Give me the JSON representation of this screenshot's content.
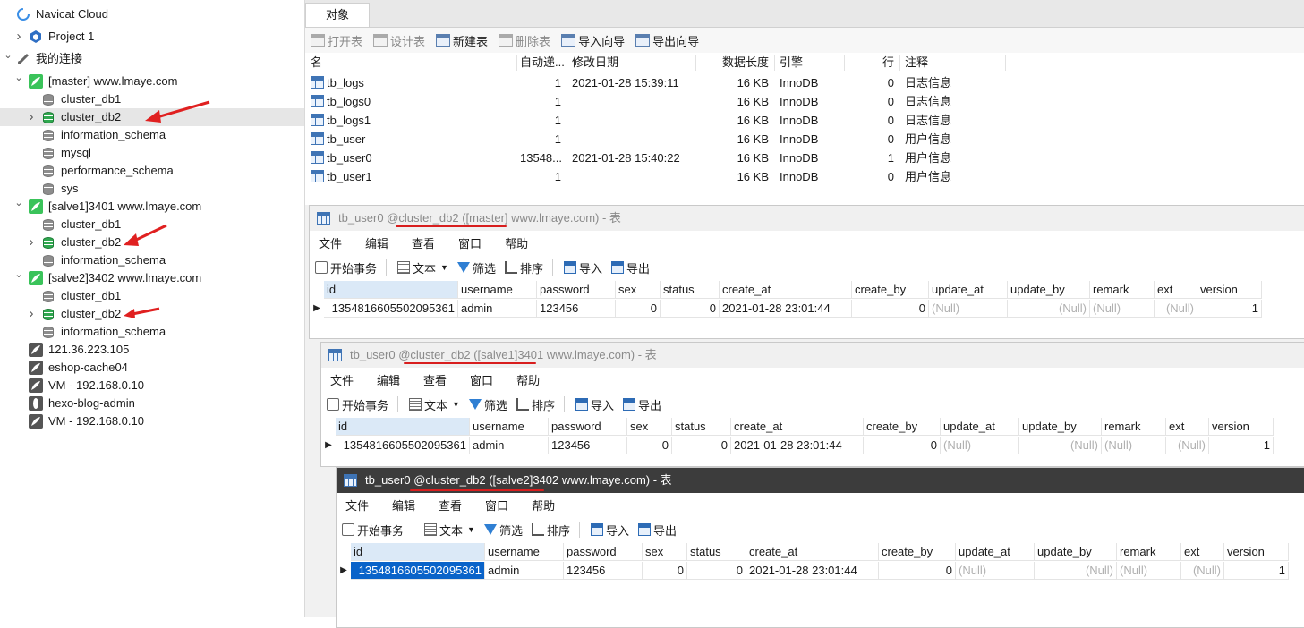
{
  "sidebar": {
    "items": [
      {
        "label": "Navicat Cloud",
        "icon": "cloud-icon"
      },
      {
        "label": "Project 1",
        "icon": "project-icon"
      },
      {
        "label": "我的连接",
        "icon": "connections-icon"
      },
      {
        "label": "[master] www.lmaye.com",
        "icon": "mysql-connection-icon"
      },
      {
        "label": "cluster_db1",
        "icon": "database-icon"
      },
      {
        "label": "cluster_db2",
        "icon": "database-open-icon",
        "selected": true
      },
      {
        "label": "information_schema",
        "icon": "database-icon"
      },
      {
        "label": "mysql",
        "icon": "database-icon"
      },
      {
        "label": "performance_schema",
        "icon": "database-icon"
      },
      {
        "label": "sys",
        "icon": "database-icon"
      },
      {
        "label": "[salve1]3401 www.lmaye.com",
        "icon": "mysql-connection-icon"
      },
      {
        "label": "cluster_db1",
        "icon": "database-icon"
      },
      {
        "label": "cluster_db2",
        "icon": "database-open-icon"
      },
      {
        "label": "information_schema",
        "icon": "database-icon"
      },
      {
        "label": "[salve2]3402 www.lmaye.com",
        "icon": "mysql-connection-icon"
      },
      {
        "label": "cluster_db1",
        "icon": "database-icon"
      },
      {
        "label": "cluster_db2",
        "icon": "database-open-icon"
      },
      {
        "label": "information_schema",
        "icon": "database-icon"
      },
      {
        "label": "121.36.223.105",
        "icon": "mysql-connection-icon"
      },
      {
        "label": "eshop-cache04",
        "icon": "mysql-connection-icon"
      },
      {
        "label": "VM - 192.168.0.10",
        "icon": "mysql-connection-icon"
      },
      {
        "label": "hexo-blog-admin",
        "icon": "postgres-connection-icon"
      },
      {
        "label": "VM - 192.168.0.10",
        "icon": "mongodb-connection-icon"
      }
    ]
  },
  "tabs": {
    "objects": "对象"
  },
  "object_toolbar": {
    "open_table": "打开表",
    "design_table": "设计表",
    "new_table": "新建表",
    "delete_table": "删除表",
    "import_wizard": "导入向导",
    "export_wizard": "导出向导"
  },
  "object_list": {
    "headers": {
      "name": "名",
      "auto_inc": "自动递...",
      "modified": "修改日期",
      "data_length": "数据长度",
      "engine": "引擎",
      "rows": "行",
      "comment": "注释"
    },
    "rows": [
      {
        "name": "tb_logs",
        "auto_inc": "1",
        "modified": "2021-01-28 15:39:11",
        "data_length": "16 KB",
        "engine": "InnoDB",
        "rows": "0",
        "comment": "日志信息"
      },
      {
        "name": "tb_logs0",
        "auto_inc": "1",
        "modified": "",
        "data_length": "16 KB",
        "engine": "InnoDB",
        "rows": "0",
        "comment": "日志信息"
      },
      {
        "name": "tb_logs1",
        "auto_inc": "1",
        "modified": "",
        "data_length": "16 KB",
        "engine": "InnoDB",
        "rows": "0",
        "comment": "日志信息"
      },
      {
        "name": "tb_user",
        "auto_inc": "1",
        "modified": "",
        "data_length": "16 KB",
        "engine": "InnoDB",
        "rows": "0",
        "comment": "用户信息"
      },
      {
        "name": "tb_user0",
        "auto_inc": "13548...",
        "modified": "2021-01-28 15:40:22",
        "data_length": "16 KB",
        "engine": "InnoDB",
        "rows": "1",
        "comment": "用户信息"
      },
      {
        "name": "tb_user1",
        "auto_inc": "1",
        "modified": "",
        "data_length": "16 KB",
        "engine": "InnoDB",
        "rows": "0",
        "comment": "用户信息"
      }
    ]
  },
  "query_menu": {
    "file": "文件",
    "edit": "编辑",
    "view": "查看",
    "window": "窗口",
    "help": "帮助"
  },
  "query_toolbar": {
    "begin_txn": "开始事务",
    "text": "文本",
    "filter": "筛选",
    "sort": "排序",
    "import": "导入",
    "export": "导出"
  },
  "grid_headers": [
    "id",
    "username",
    "password",
    "sex",
    "status",
    "create_at",
    "create_by",
    "update_at",
    "update_by",
    "remark",
    "ext",
    "version"
  ],
  "windows": [
    {
      "title_prefix": "tb_user0 ",
      "title_highlight": "@cluster_db2 ([master]",
      "title_suffix": " www.lmaye.com) - 表",
      "row": [
        "1354816605502095361",
        "admin",
        "123456",
        "0",
        "0",
        "2021-01-28 23:01:44",
        "0",
        "(Null)",
        "(Null)",
        "(Null)",
        "(Null)",
        "1"
      ]
    },
    {
      "title_prefix": "tb_user0 ",
      "title_highlight": "@cluster_db2 ([salve1]3401",
      "title_suffix": " www.lmaye.com) - 表",
      "row": [
        "1354816605502095361",
        "admin",
        "123456",
        "0",
        "0",
        "2021-01-28 23:01:44",
        "0",
        "(Null)",
        "(Null)",
        "(Null)",
        "(Null)",
        "1"
      ]
    },
    {
      "title_prefix": "tb_user0 ",
      "title_highlight": "@cluster_db2 ([salve2]3402",
      "title_suffix": " www.lmaye.com) - 表",
      "row": [
        "1354816605502095361",
        "admin",
        "123456",
        "0",
        "0",
        "2021-01-28 23:01:44",
        "0",
        "(Null)",
        "(Null)",
        "(Null)",
        "(Null)",
        "1"
      ]
    }
  ]
}
